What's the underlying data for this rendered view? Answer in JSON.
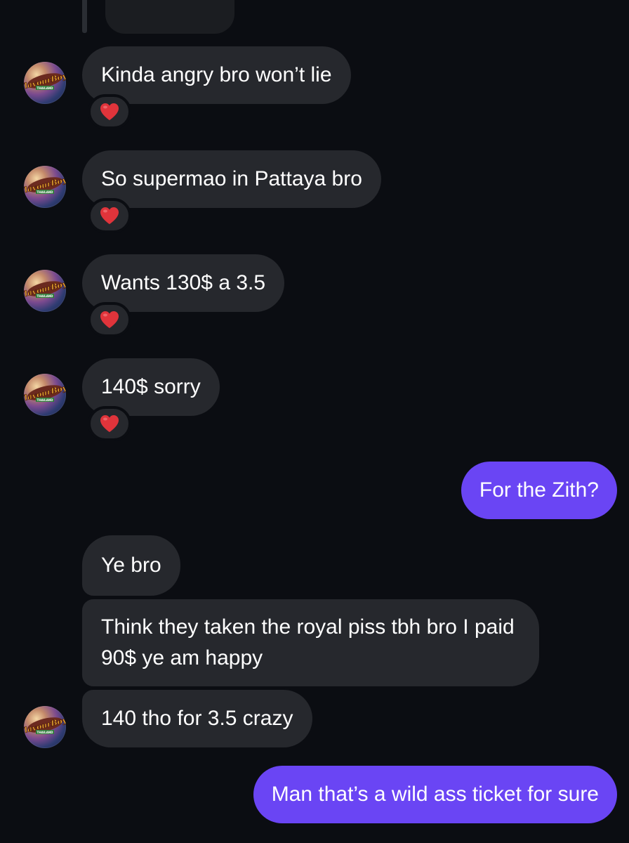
{
  "colors": {
    "background": "#0b0d12",
    "incoming_bubble": "#26282d",
    "outgoing_bubble": "#6a45f4",
    "reaction_heart": "#e0343b"
  },
  "avatar": {
    "name": "FlavourBoyz",
    "sub": "THAILAND"
  },
  "messages": [
    {
      "direction": "incoming",
      "text": "Kinda angry bro won’t lie",
      "reaction": "red-heart-icon"
    },
    {
      "direction": "incoming",
      "text": "So supermao in Pattaya bro",
      "reaction": "red-heart-icon"
    },
    {
      "direction": "incoming",
      "text": "Wants 130$ a 3.5",
      "reaction": "red-heart-icon"
    },
    {
      "direction": "incoming",
      "text": "140$ sorry",
      "reaction": "red-heart-icon"
    },
    {
      "direction": "outgoing",
      "text": "For the Zith?"
    },
    {
      "direction": "incoming",
      "text": "Ye bro"
    },
    {
      "direction": "incoming",
      "text": "Think they taken the royal piss tbh bro I paid 90$ ye am happy"
    },
    {
      "direction": "incoming",
      "text": "140 tho for 3.5 crazy"
    },
    {
      "direction": "outgoing",
      "text": "Man that’s a wild ass ticket for sure"
    }
  ]
}
